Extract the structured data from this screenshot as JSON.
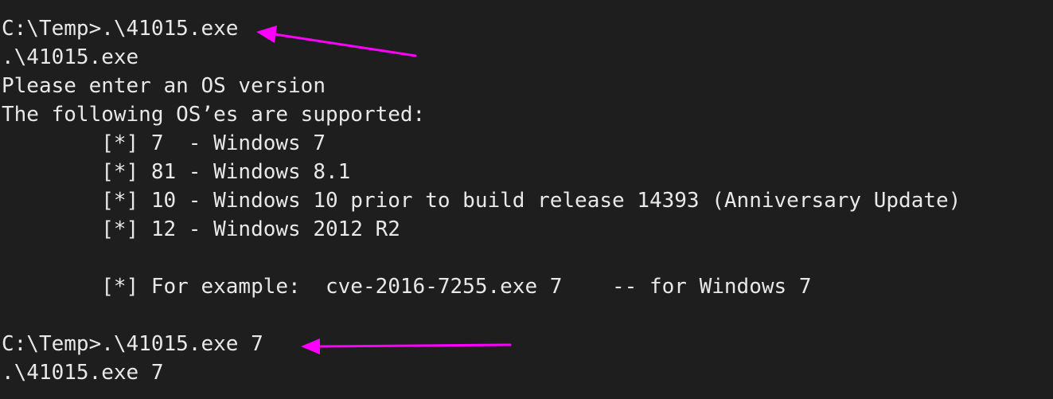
{
  "terminal": {
    "lines": [
      "C:\\Temp>.\\41015.exe",
      ".\\41015.exe",
      "Please enter an OS version",
      "The following OS’es are supported:",
      "        [*] 7  - Windows 7",
      "        [*] 81 - Windows 8.1",
      "        [*] 10 - Windows 10 prior to build release 14393 (Anniversary Update)",
      "        [*] 12 - Windows 2012 R2",
      "",
      "        [*] For example:  cve-2016-7255.exe 7    -- for Windows 7",
      "",
      "C:\\Temp>.\\41015.exe 7",
      ".\\41015.exe 7"
    ]
  },
  "annotations": {
    "arrow_color": "#ff00ff",
    "background_color": "#1e1e1e",
    "text_color": "#e8e8e8"
  }
}
